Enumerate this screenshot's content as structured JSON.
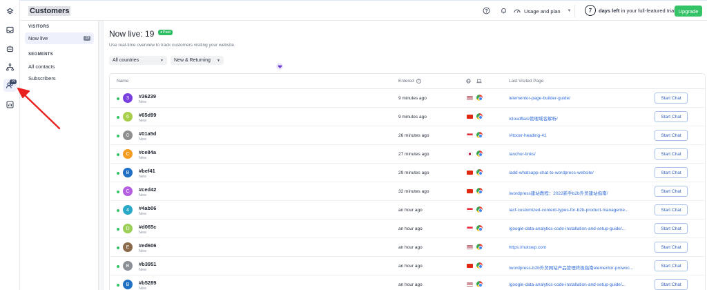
{
  "app": {
    "title": "Customers"
  },
  "topbar": {
    "usage_label": "Usage and plan",
    "trial_days": "7",
    "trial_bold": "days left",
    "trial_rest": "in your full-featured trial",
    "upgrade_label": "Upgrade"
  },
  "rail": {
    "badge": "19"
  },
  "subnav": {
    "visitors_title": "VISITORS",
    "now_live_label": "Now live",
    "now_live_count": "19",
    "segments_title": "SEGMENTS",
    "all_contacts_label": "All contacts",
    "subscribers_label": "Subscribers"
  },
  "main": {
    "title": "Now live: 19",
    "paid_badge": "Paid",
    "subtitle": "Use real-time overview to track customers visiting your website.",
    "filter_country": "All countries",
    "filter_type": "New & Returning"
  },
  "table": {
    "col_name": "Name",
    "col_entered": "Entered",
    "col_page": "Last Visited Page",
    "chat_label": "Start Chat",
    "rows": [
      {
        "initial": "3",
        "color": "#7a3fe0",
        "id": "#36239",
        "status": "New",
        "entered": "9 minutes ago",
        "flag": "us",
        "page": "/elementor-page-builder-guide/"
      },
      {
        "initial": "6",
        "color": "#a8cf4a",
        "id": "#65d99",
        "status": "New",
        "entered": "9 minutes ago",
        "flag": "hk",
        "page": "/cloudflare管理域名解析/"
      },
      {
        "initial": "0",
        "color": "#8f8f8f",
        "id": "#01a5d",
        "status": "New",
        "entered": "26 minutes ago",
        "flag": "sg",
        "page": "/#tocer-heading-41"
      },
      {
        "initial": "C",
        "color": "#f39c1f",
        "id": "#ce84a",
        "status": "New",
        "entered": "27 minutes ago",
        "flag": "jp",
        "page": "/anchor-links/"
      },
      {
        "initial": "B",
        "color": "#1f6fc4",
        "id": "#bef41",
        "status": "New",
        "entered": "29 minutes ago",
        "flag": "hk",
        "page": "/add-whatsapp-chat-to-wordpress-website/"
      },
      {
        "initial": "C",
        "color": "#b45fe0",
        "id": "#ced42",
        "status": "New",
        "entered": "32 minutes ago",
        "flag": "cn",
        "page": "/wordpress建站教程：2022新手b2b外贸建站指南/"
      },
      {
        "initial": "4",
        "color": "#29a9c7",
        "id": "#4ab06",
        "status": "New",
        "entered": "an hour ago",
        "flag": "sg",
        "page": "/acf-customized-content-types-for-b2b-product-manageme..."
      },
      {
        "initial": "D",
        "color": "#9bcf57",
        "id": "#d065c",
        "status": "New",
        "entered": "an hour ago",
        "flag": "sg",
        "page": "/google-data-analytics-code-installation-and-setup-guide/..."
      },
      {
        "initial": "E",
        "color": "#8a6a4a",
        "id": "#ed606",
        "status": "New",
        "entered": "an hour ago",
        "flag": "us",
        "page": "https://nutswp.com"
      },
      {
        "initial": "B",
        "color": "#8b8f96",
        "id": "#b3951",
        "status": "New",
        "entered": "an hour ago",
        "flag": "hk",
        "page": "/wordpress-b2b外贸网站产品管理终极指南elementor-prowoc..."
      },
      {
        "initial": "B",
        "color": "#1f6fc4",
        "id": "#b5289",
        "status": "New",
        "entered": "an hour ago",
        "flag": "us",
        "page": "/google-data-analytics-code-installation-and-setup-guide/..."
      }
    ]
  }
}
